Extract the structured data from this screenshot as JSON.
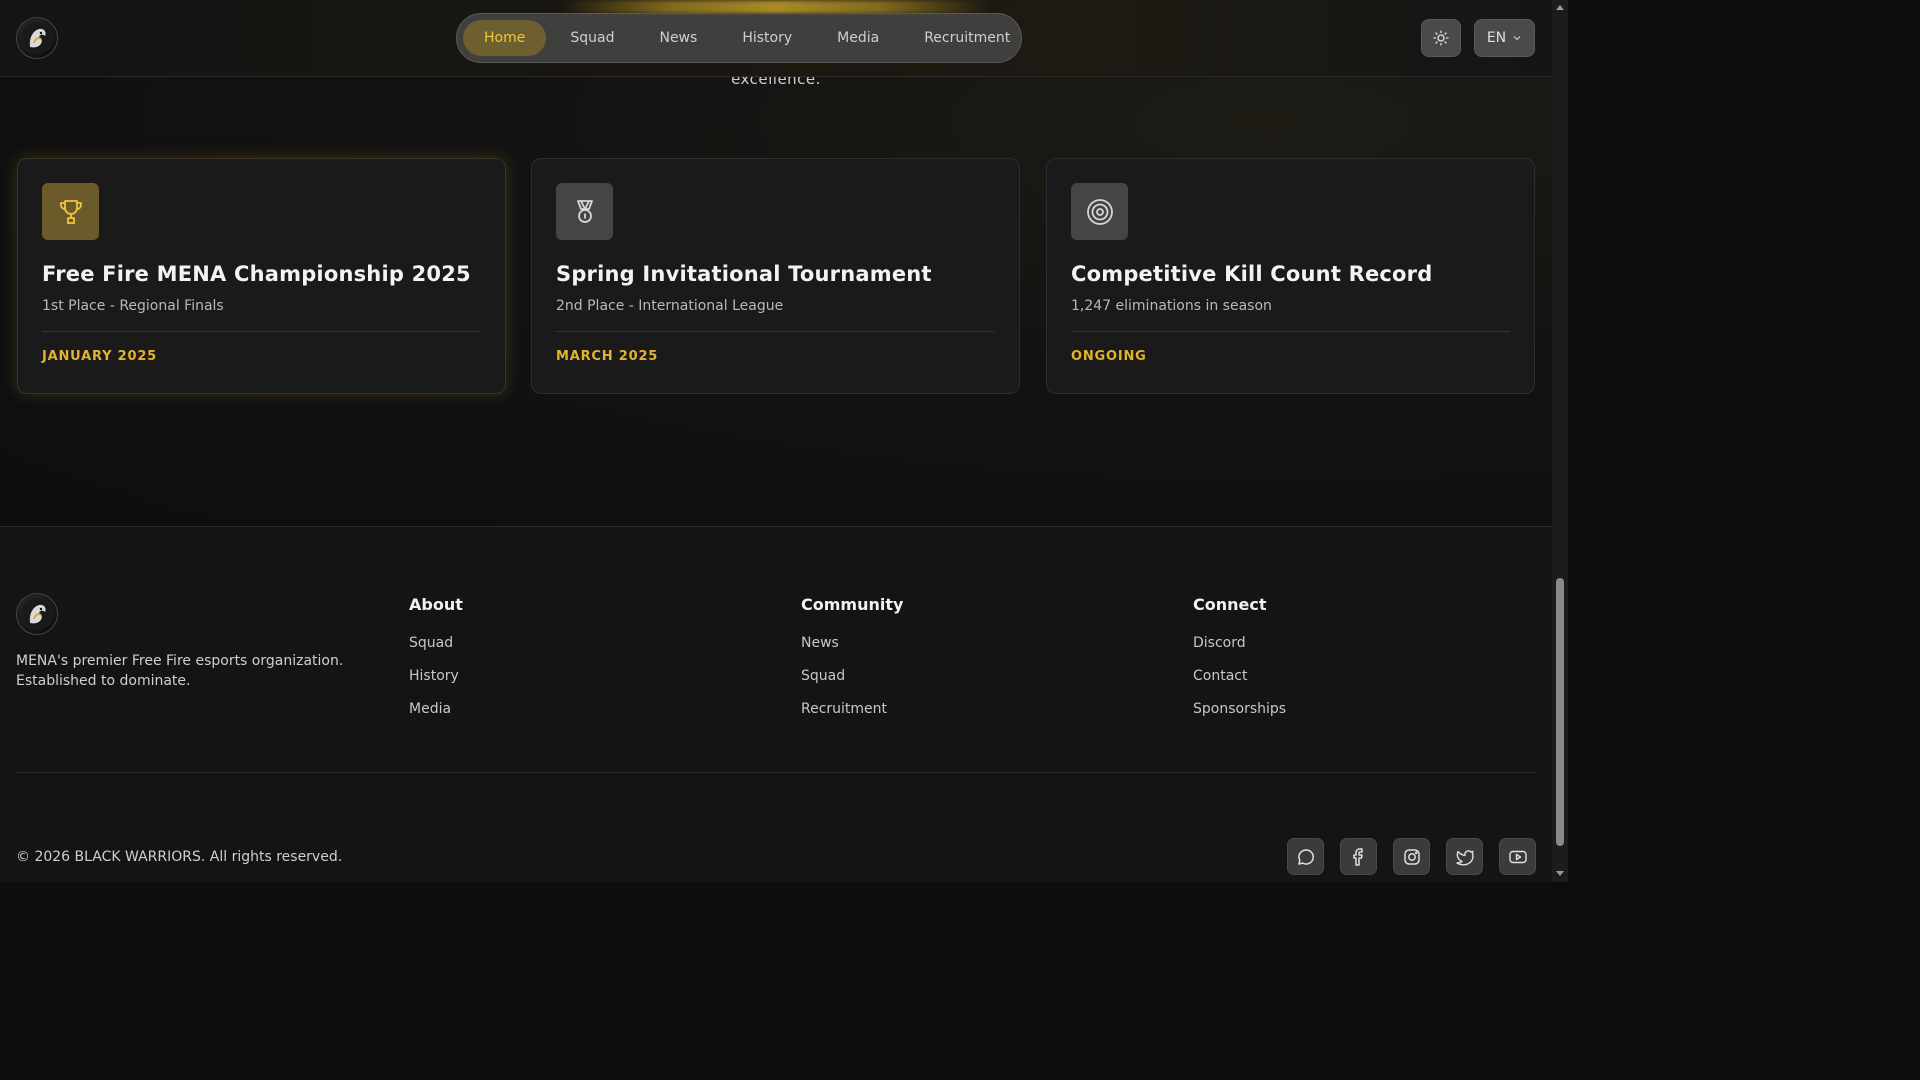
{
  "header": {
    "nav": [
      {
        "label": "Home",
        "active": true
      },
      {
        "label": "Squad",
        "active": false
      },
      {
        "label": "News",
        "active": false
      },
      {
        "label": "History",
        "active": false
      },
      {
        "label": "Media",
        "active": false
      },
      {
        "label": "Recruitment",
        "active": false
      }
    ],
    "lang": "EN",
    "icons": {
      "theme": "sun-icon",
      "lang_caret": "chevron-down-icon",
      "logo": "lion-logo-icon"
    }
  },
  "main": {
    "intro_tail": "excellence.",
    "achievements": [
      {
        "icon": "trophy-icon",
        "title": "Free Fire MENA Championship 2025",
        "subtitle": "1st Place - Regional Finals",
        "date": "January 2025"
      },
      {
        "icon": "medal-icon",
        "title": "Spring Invitational Tournament",
        "subtitle": "2nd Place - International League",
        "date": "March 2025"
      },
      {
        "icon": "target-icon",
        "title": "Competitive Kill Count Record",
        "subtitle": "1,247 eliminations in season",
        "date": "Ongoing"
      }
    ]
  },
  "footer": {
    "description": "MENA's premier Free Fire esports organization. Established to dominate.",
    "columns": [
      {
        "title": "About",
        "links": [
          "Squad",
          "History",
          "Media"
        ]
      },
      {
        "title": "Community",
        "links": [
          "News",
          "Squad",
          "Recruitment"
        ]
      },
      {
        "title": "Connect",
        "links": [
          "Discord",
          "Contact",
          "Sponsorships"
        ]
      }
    ],
    "copyright": "© 2026 BLACK WARRIORS. All rights reserved.",
    "socials": [
      "discord-chat-icon",
      "facebook-icon",
      "instagram-icon",
      "twitter-icon",
      "youtube-icon"
    ]
  },
  "colors": {
    "accent": "#e3b32e",
    "background": "#0d0d0d",
    "card": "#1a1a1a"
  }
}
